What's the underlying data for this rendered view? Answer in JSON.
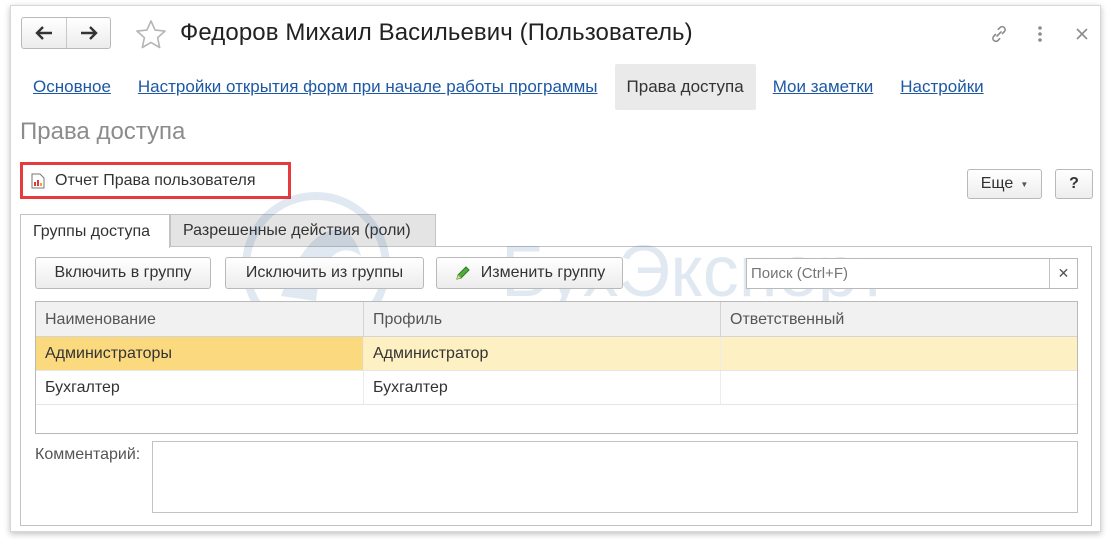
{
  "window": {
    "title": "Федоров Михаил Васильевич (Пользователь)"
  },
  "icons": {
    "back": "arrow-left-icon",
    "forward": "arrow-right-icon",
    "favorite": "star-icon",
    "link": "link-icon",
    "more": "vertical-dots-icon",
    "close": "close-icon",
    "report": "report-chart-icon",
    "edit": "pencil-icon"
  },
  "sections": [
    {
      "label": "Основное"
    },
    {
      "label": "Настройки открытия форм при начале работы программы"
    },
    {
      "label": "Права доступа"
    },
    {
      "label": "Мои заметки"
    },
    {
      "label": "Настройки"
    }
  ],
  "page": {
    "title": "Права доступа"
  },
  "toolbar": {
    "report_label": "Отчет Права пользователя",
    "more_label": "Еще",
    "help_label": "?"
  },
  "tabs": [
    {
      "label": "Группы доступа"
    },
    {
      "label": "Разрешенные действия (роли)"
    }
  ],
  "actions": {
    "include_label": "Включить в группу",
    "exclude_label": "Исключить из группы",
    "edit_label": "Изменить группу"
  },
  "search": {
    "placeholder": "Поиск (Ctrl+F)"
  },
  "table": {
    "columns": [
      "Наименование",
      "Профиль",
      "Ответственный"
    ],
    "rows": [
      {
        "name": "Администраторы",
        "profile": "Администратор",
        "responsible": ""
      },
      {
        "name": "Бухгалтер",
        "profile": "Бухгалтер",
        "responsible": ""
      }
    ]
  },
  "comment": {
    "label": "Комментарий:",
    "value": ""
  },
  "watermark": {
    "text": "БухЭксперт"
  },
  "colors": {
    "link": "#1d58a4",
    "highlight_border": "#e53b3e",
    "selected_row": "#fdf0c3",
    "selected_cell": "#fbd97f"
  }
}
